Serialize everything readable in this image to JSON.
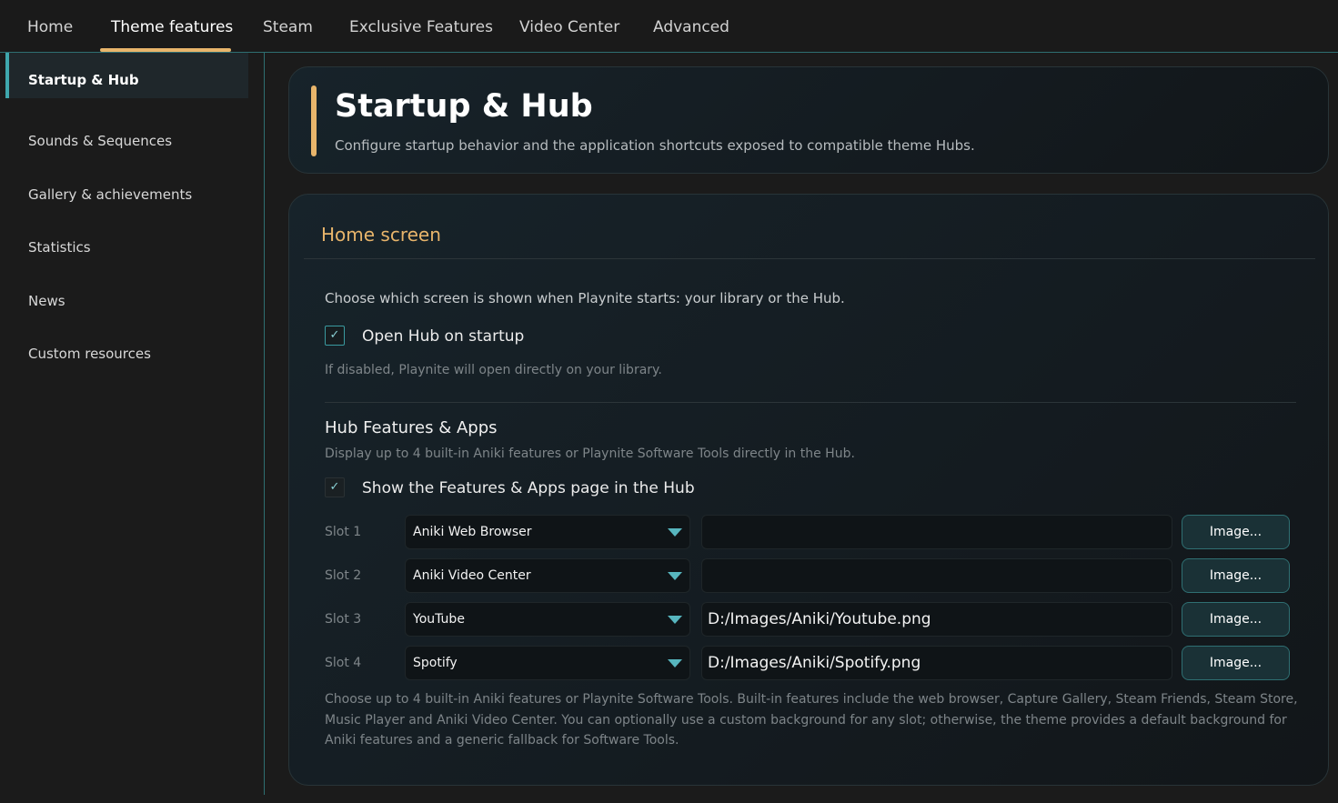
{
  "tabs": [
    "Home",
    "Theme features",
    "Steam",
    "Exclusive Features",
    "Video Center",
    "Advanced"
  ],
  "active_tab": "Theme features",
  "sidebar": {
    "items": [
      "Startup & Hub",
      "Sounds & Sequences",
      "Gallery & achievements",
      "Statistics",
      "News",
      "Custom resources"
    ],
    "active": "Startup & Hub"
  },
  "header": {
    "title": "Startup & Hub",
    "subtitle": "Configure startup behavior and the application shortcuts exposed to compatible theme Hubs."
  },
  "home_screen": {
    "title": "Home screen",
    "description": "Choose which screen is shown when Playnite starts: your library or the Hub.",
    "open_hub_label": "Open Hub on startup",
    "open_hub_checked": true,
    "open_hub_hint": "If disabled, Playnite will open directly on your library.",
    "check_glyph": "✓"
  },
  "hub_features": {
    "title": "Hub Features & Apps",
    "description": "Display up to 4 built-in Aniki features or Playnite Software Tools directly in the Hub.",
    "show_page_label": "Show the Features & Apps page in the Hub",
    "show_page_checked": true,
    "slots": [
      {
        "label": "Slot 1",
        "selection": "Aniki Web Browser",
        "image_path": "",
        "button": "Image..."
      },
      {
        "label": "Slot 2",
        "selection": "Aniki Video Center",
        "image_path": "",
        "button": "Image..."
      },
      {
        "label": "Slot 3",
        "selection": "YouTube",
        "image_path": "D:/Images/Aniki/Youtube.png",
        "button": "Image..."
      },
      {
        "label": "Slot 4",
        "selection": "Spotify",
        "image_path": "D:/Images/Aniki/Spotify.png",
        "button": "Image..."
      }
    ],
    "note": "Choose up to 4 built-in Aniki features or Playnite Software Tools. Built-in features include the web browser, Capture Gallery, Steam Friends, Steam Store, Music Player and Aniki Video Center. You can optionally use a custom background for any slot; otherwise, the theme provides a default background for Aniki features and a generic fallback for Software Tools."
  },
  "colors": {
    "accent": "#e8b56b",
    "teal": "#3fa7ad",
    "background": "#1b1b1b"
  }
}
